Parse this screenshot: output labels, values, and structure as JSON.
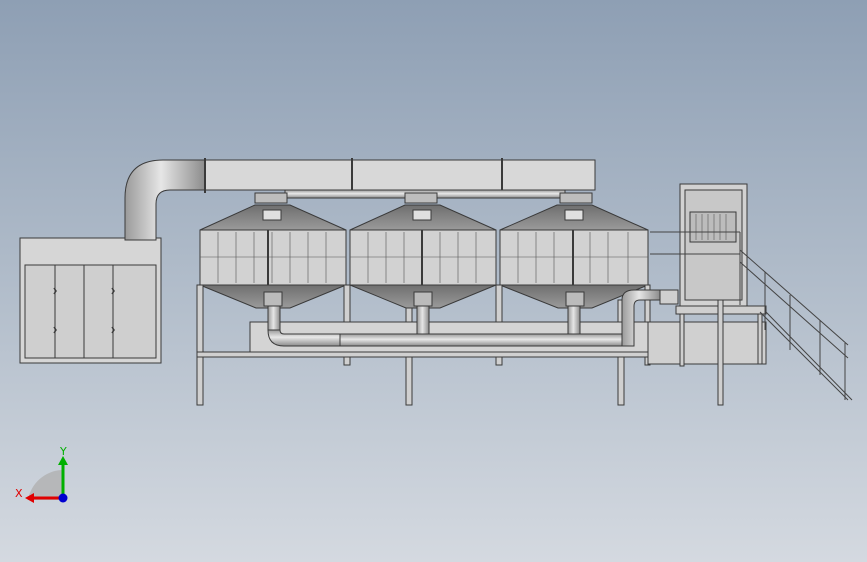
{
  "viewport": {
    "background_top": "#8e9fb4",
    "background_bottom": "#d4d9e0"
  },
  "model": {
    "description_color_body": "#d6d6d6",
    "hopper_color": "#7d7d7d",
    "outline_color": "#3a3a3a"
  },
  "triad": {
    "x_label": "X",
    "y_label": "Y",
    "x_color": "#e00000",
    "y_color": "#00b000",
    "z_color": "#0000d0"
  }
}
